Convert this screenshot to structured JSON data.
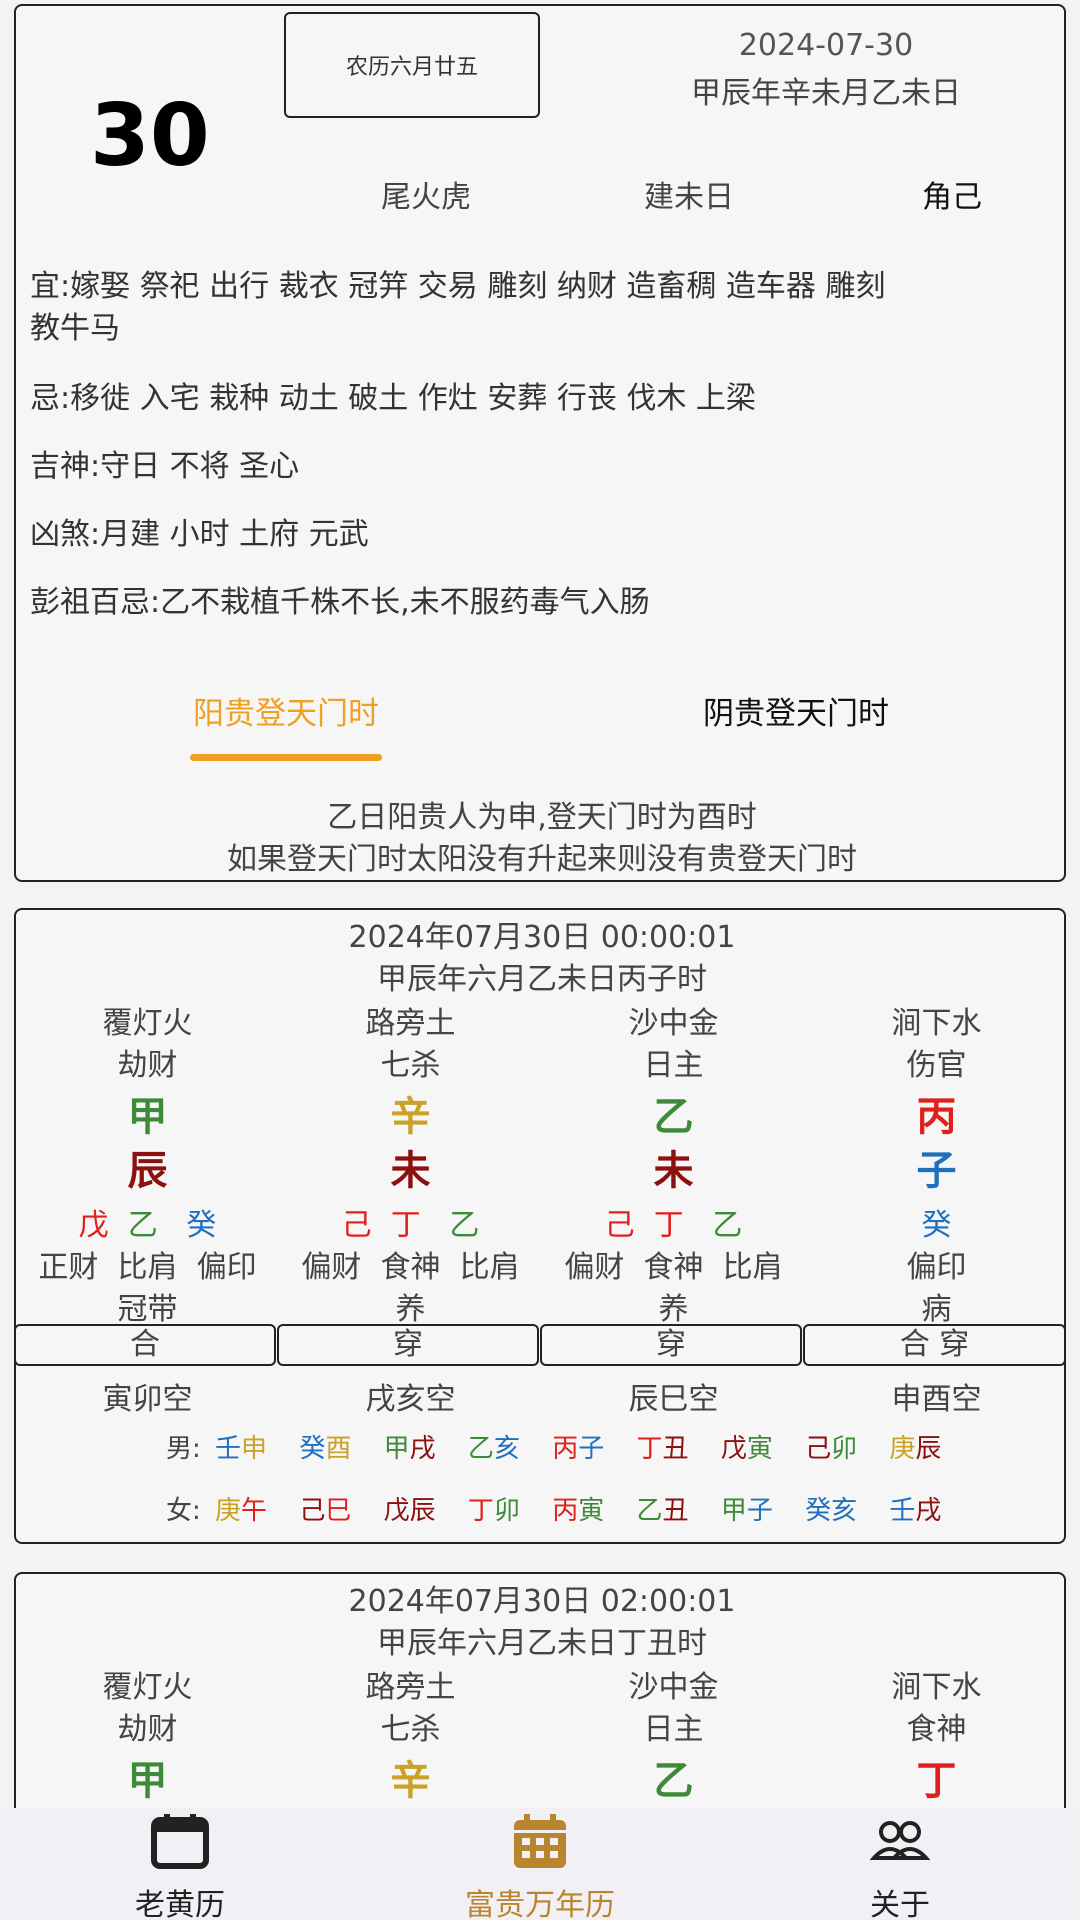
{
  "header": {
    "day": "30",
    "lunar": "农历六月廿五",
    "solar": "2024-07-30",
    "ganzhi": "甲辰年辛未月乙未日",
    "xiu": "尾火虎",
    "jianchu": "建未日",
    "other": "角己"
  },
  "almanac": {
    "yi": "宜:嫁娶  祭祀 出行 裁衣 冠笄 交易 雕刻 纳财 造畜稠  造车器  雕刻",
    "yi_cont": "教牛马",
    "ji": "忌:移徙  入宅 栽种 动土 破土 作灶 安葬 行丧 伐木 上梁",
    "jishen": "吉神:守日   不将 圣心",
    "xiongsha": "凶煞:月建   小时 土府 元武",
    "pengzu": "彭祖百忌:乙不栽植千株不长,未不服药毒气入肠"
  },
  "tabs": {
    "yang": "阳贵登天门时",
    "yin": "阴贵登天门时",
    "desc1": "乙日阳贵人为申,登天门时为酉时",
    "desc2": "如果登天门时太阳没有升起来则没有贵登天门时"
  },
  "bazi1": {
    "datetime": "2024年07月30日 00:00:01",
    "ganzhi": "甲辰年六月乙未日丙子时",
    "nayin": [
      "覆灯火",
      "路旁土",
      "沙中金",
      "涧下水"
    ],
    "shishen": [
      "劫财",
      "七杀",
      "日主",
      "伤官"
    ],
    "gan": [
      "甲",
      "辛",
      "乙",
      "丙"
    ],
    "zhi": [
      "辰",
      "未",
      "未",
      "子"
    ],
    "canggan": [
      [
        "戊",
        "乙",
        "癸"
      ],
      [
        "己",
        "丁",
        "乙"
      ],
      [
        "己",
        "丁",
        "乙"
      ],
      [
        "癸"
      ]
    ],
    "cangshishen": [
      "正财  比肩  偏印",
      "偏财  食神  比肩",
      "偏财  食神  比肩",
      "偏印"
    ],
    "changsheng": [
      "冠带",
      "养",
      "养",
      "病"
    ],
    "relations": [
      "合",
      "穿",
      "穿",
      "合 穿"
    ],
    "kongwang": [
      "寅卯空",
      "戌亥空",
      "辰巳空",
      "申酉空"
    ],
    "male_label": "男:",
    "male": [
      "壬申",
      "癸酉",
      "甲戌",
      "乙亥",
      "丙子",
      "丁丑",
      "戊寅",
      "己卯",
      "庚辰"
    ],
    "female_label": "女:",
    "female": [
      "庚午",
      "己巳",
      "戊辰",
      "丁卯",
      "丙寅",
      "乙丑",
      "甲子",
      "癸亥",
      "壬戌"
    ]
  },
  "bazi2": {
    "datetime": "2024年07月30日 02:00:01",
    "ganzhi": "甲辰年六月乙未日丁丑时",
    "nayin": [
      "覆灯火",
      "路旁土",
      "沙中金",
      "涧下水"
    ],
    "shishen": [
      "劫财",
      "七杀",
      "日主",
      "食神"
    ],
    "gan": [
      "甲",
      "辛",
      "乙",
      "丁"
    ]
  },
  "colors": {
    "wood": "#3f8a3a",
    "metal": "#c9a227",
    "fire": "#e0201c",
    "water": "#2070c0",
    "earth": "#8b1010",
    "accent": "#f0a020",
    "nav_active": "#b8862e",
    "nav_inactive": "#222222"
  },
  "nav": {
    "items": [
      {
        "label": "老黄历",
        "icon": "calendar-outline-icon"
      },
      {
        "label": "富贵万年历",
        "icon": "calendar-filled-icon"
      },
      {
        "label": "关于",
        "icon": "people-icon"
      }
    ],
    "active_index": 1
  }
}
